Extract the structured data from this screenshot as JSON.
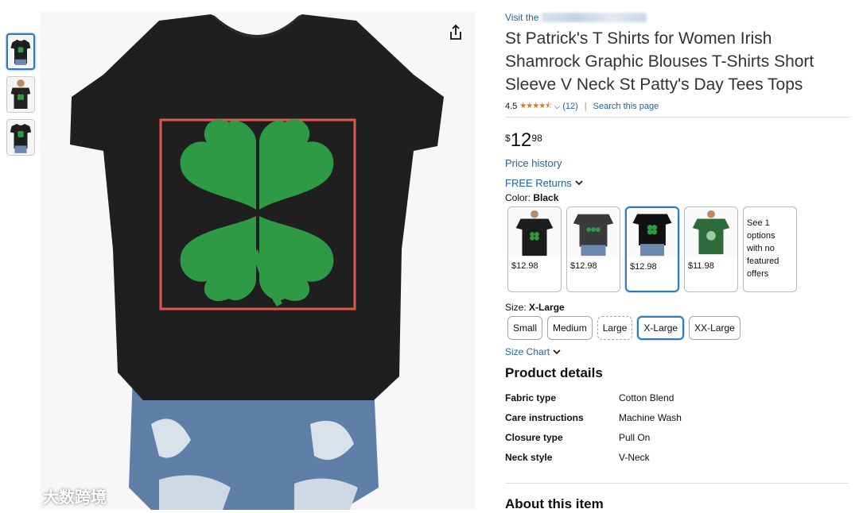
{
  "thumbnails": [
    {
      "label": "thumbnail-1",
      "selected": true
    },
    {
      "label": "thumbnail-2",
      "selected": false
    },
    {
      "label": "thumbnail-3",
      "selected": false
    }
  ],
  "watermark": {
    "text": "大数跨境"
  },
  "store": {
    "prefix": "Visit the"
  },
  "product": {
    "title": "St Patrick's T Shirts for Women Irish Shamrock Graphic Blouses T-Shirts Short Sleeve V Neck St Patty's Day Tees Tops",
    "rating_value": "4.5",
    "stars": "★★★★⯪",
    "review_count": "(12)",
    "search_page_link": "Search this page"
  },
  "price": {
    "symbol": "$",
    "whole": "12",
    "fraction": "98"
  },
  "links": {
    "price_history": "Price history",
    "free_returns": "FREE Returns",
    "size_chart": "Size Chart"
  },
  "color": {
    "label": "Color:",
    "selected": "Black",
    "options": [
      {
        "price": "$12.98",
        "shirt_color": "#1c1c1c"
      },
      {
        "price": "$12.98",
        "shirt_color": "#3a3a3a"
      },
      {
        "price": "$12.98",
        "shirt_color": "#111111",
        "selected": true
      },
      {
        "price": "$11.98",
        "shirt_color": "#2e6b3a"
      }
    ],
    "more_text": "See 1 options with no featured offers"
  },
  "size": {
    "label": "Size:",
    "selected": "X-Large",
    "options": [
      "Small",
      "Medium",
      "Large",
      "X-Large",
      "XX-Large"
    ]
  },
  "details": {
    "heading": "Product details",
    "rows": [
      {
        "key": "Fabric type",
        "value": "Cotton Blend"
      },
      {
        "key": "Care instructions",
        "value": "Machine Wash"
      },
      {
        "key": "Closure type",
        "value": "Pull On"
      },
      {
        "key": "Neck style",
        "value": "V-Neck"
      }
    ]
  },
  "about": {
    "heading": "About this item"
  },
  "colors": {
    "link": "#2162a1",
    "star": "#de7921",
    "selected_border": "#2f7ab8",
    "highlight_box": "#e0574f",
    "shamrock": "#2f9a45"
  }
}
